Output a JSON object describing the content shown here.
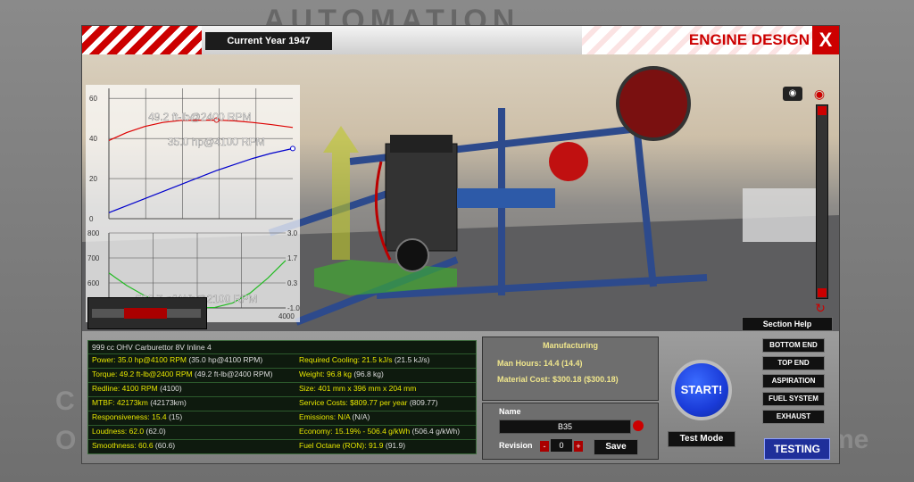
{
  "background": {
    "title_fragment": "AUTOMATION",
    "left_fragment_1": "C",
    "left_fragment_2": "O",
    "right_fragment": "me"
  },
  "header": {
    "current_year": "Current Year 1947",
    "screen_title": "ENGINE DESIGN",
    "close_label": "X"
  },
  "colors": {
    "accent_red": "#cc0000",
    "value_yellow": "#e6e600",
    "testing_blue": "#1f2f9a"
  },
  "icons": [
    "camera-icon",
    "eye-icon",
    "rotate-icon",
    "close-icon"
  ],
  "section_help": "Section Help",
  "chart_data": [
    {
      "type": "line",
      "x": [
        0,
        400,
        800,
        1200,
        1600,
        2000,
        2400,
        2800,
        3200,
        3600,
        4100
      ],
      "series": [
        {
          "values": [
            39,
            43,
            46,
            48,
            49,
            49.1,
            49.2,
            48.8,
            48,
            47,
            45.5
          ],
          "color": "#dd0000"
        },
        {
          "values": [
            3,
            6.5,
            10,
            13.5,
            17,
            20.5,
            24,
            27,
            30,
            32.5,
            35
          ],
          "color": "#0000cc"
        }
      ],
      "ylim": [
        0,
        65
      ],
      "xlim": [
        0,
        4100
      ],
      "yticks": [
        "60",
        "40",
        "20",
        "0"
      ],
      "annotations": [
        "49.2 ft-lb@2400 RPM",
        "35.0 hp@4100 RPM"
      ],
      "grid": true
    },
    {
      "type": "line",
      "x": [
        0,
        400,
        800,
        1200,
        1600,
        2100,
        2400,
        2800,
        3200,
        3600,
        4000
      ],
      "series": [
        {
          "values": [
            640,
            590,
            550,
            520,
            505,
            500.7,
            502,
            520,
            560,
            620,
            690
          ],
          "color": "#22bb22"
        }
      ],
      "ylim": [
        500,
        800
      ],
      "xticks": [
        "0",
        "2000",
        "4000"
      ],
      "yticks_left": [
        "800",
        "700",
        "600",
        "500"
      ],
      "yticks_right": [
        "3.0",
        "1.7",
        "0.3",
        "-1.0"
      ],
      "annotations": [
        "500.7 g/kWh@2100 RPM"
      ],
      "grid": true
    }
  ],
  "stats": {
    "title": "999 cc OHV Carburettor 8V Inline 4",
    "rows": [
      {
        "left_label": "Power:",
        "left_value": "35.0 hp@4100 RPM",
        "left_raw": "(35.0 hp@4100 RPM)",
        "right_label": "Required Cooling:",
        "right_value": "21.5 kJ/s",
        "right_raw": "(21.5 kJ/s)"
      },
      {
        "left_label": "Torque:",
        "left_value": "49.2 ft-lb@2400 RPM",
        "left_raw": "(49.2 ft-lb@2400 RPM)",
        "right_label": "Weight:",
        "right_value": "96.8 kg",
        "right_raw": "(96.8 kg)"
      },
      {
        "left_label": "Redline:",
        "left_value": "4100 RPM",
        "left_raw": "(4100)",
        "right_label": "Size:",
        "right_value": "401 mm x 396 mm x 204 mm",
        "right_raw": ""
      },
      {
        "left_label": "MTBF:",
        "left_value": "42173km",
        "left_raw": "(42173km)",
        "right_label": "Service Costs:",
        "right_value": "$809.77 per year",
        "right_raw": "(809.77)"
      },
      {
        "left_label": "Responsiveness:",
        "left_value": "15.4",
        "left_raw": "(15)",
        "right_label": "Emissions:",
        "right_value": "N/A",
        "right_raw": "(N/A)"
      },
      {
        "left_label": "Loudness:",
        "left_value": "62.0",
        "left_raw": "(62.0)",
        "right_label": "Economy:",
        "right_value": "15.19% - 506.4 g/kWh",
        "right_raw": "(506.4 g/kWh)"
      },
      {
        "left_label": "Smoothness:",
        "left_value": "60.6",
        "left_raw": "(60.6)",
        "right_label": "Fuel Octane (RON):",
        "right_value": "91.9",
        "right_raw": "(91.9)"
      }
    ]
  },
  "manufacturing": {
    "title": "Manufacturing",
    "man_hours_label": "Man Hours:",
    "man_hours_value": "14.4 (14.4)",
    "material_cost_label": "Material Cost:",
    "material_cost_value": "$300.18 ($300.18)"
  },
  "name_panel": {
    "label": "Name",
    "value": "B35",
    "revision_label": "Revision",
    "revision_value": "0",
    "minus": "-",
    "plus": "+",
    "save_label": "Save"
  },
  "actions": {
    "start_label": "START!",
    "test_mode_label": "Test Mode"
  },
  "nav": {
    "items": [
      "BOTTOM END",
      "TOP END",
      "ASPIRATION",
      "FUEL SYSTEM",
      "EXHAUST"
    ],
    "active_label": "TESTING"
  }
}
